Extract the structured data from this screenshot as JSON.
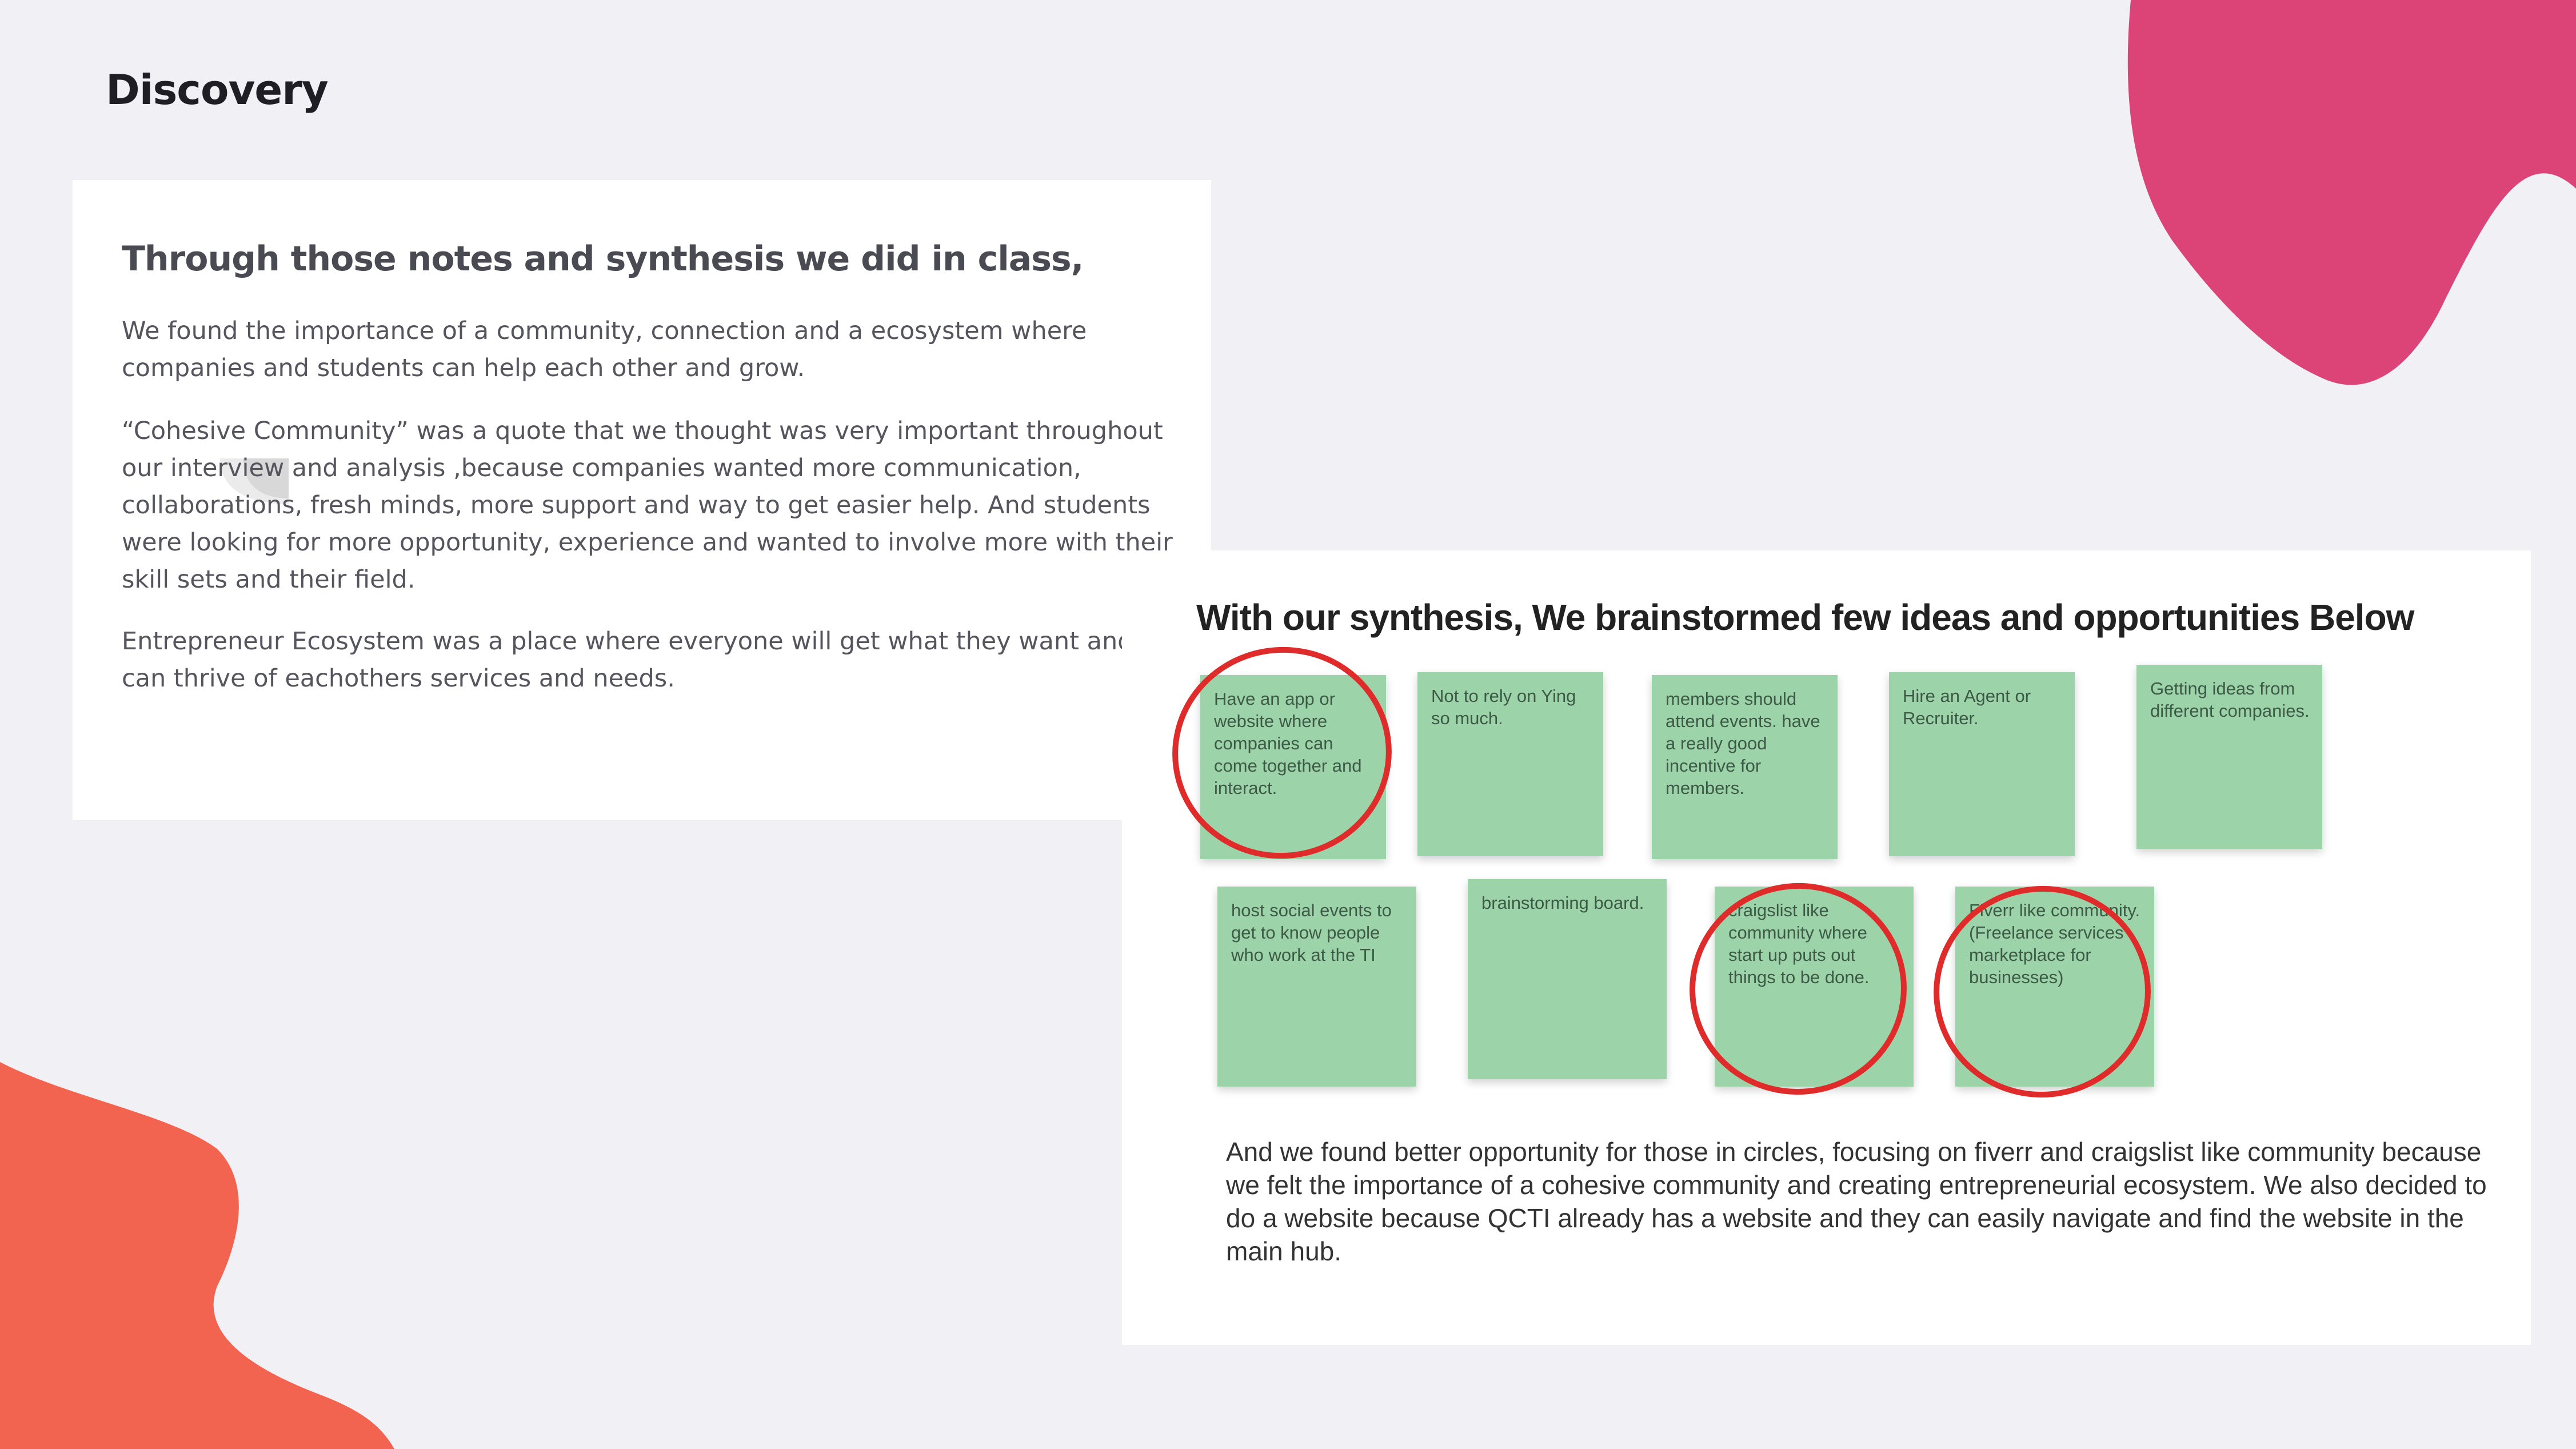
{
  "page": {
    "title": "Discovery"
  },
  "notes": {
    "heading": "Through those notes and synthesis we did in class,",
    "paragraphs": [
      "We found the importance of a community, connection and a ecosystem where companies and students can help each other and grow.",
      "“Cohesive Community” was a quote that we thought was very important throughout our interview and analysis ,because companies wanted more communication, collaborations, fresh minds, more support and way to get easier help. And students were looking for more opportunity, experience and wanted to involve more with their skill sets and their field.",
      "Entrepreneur Ecosystem was a place where everyone will get what they want and they can thrive of eachothers services and needs."
    ]
  },
  "brainstorm": {
    "heading": "With our synthesis, We brainstormed few ideas and opportunities Below",
    "sticky_notes": [
      "Have an app or website where companies can come together and interact.",
      "Not to rely on Ying so much.",
      "members should attend events. have a really good incentive for members.",
      "Hire an Agent or Recruiter.",
      "Getting ideas from different companies.",
      "host social events to get to know people who work at the TI",
      "brainstorming board.",
      "craigslist like community where start up puts out things to be done.",
      "Fiverr like community. (Freelance services marketplace for businesses)"
    ],
    "circled_notes": [
      "Have an app or website where companies can come together and interact.",
      "craigslist like community where start up puts out things to be done.",
      "Fiverr like community. (Freelance services marketplace for businesses)"
    ],
    "conclusion": "And we found better opportunity for those in circles, focusing on fiverr and craigslist like community because we felt the importance of a cohesive community and creating entrepreneurial ecosystem. We also decided to do a website because QCTI already has a website and they can easily navigate and find the website in the main hub."
  },
  "colors": {
    "background": "#f1f0f5",
    "pink_blob": "#dc4377",
    "orange_blob": "#f2644f",
    "sticky_note": "#9cd3a9",
    "circle_marker": "#e02b2b"
  }
}
